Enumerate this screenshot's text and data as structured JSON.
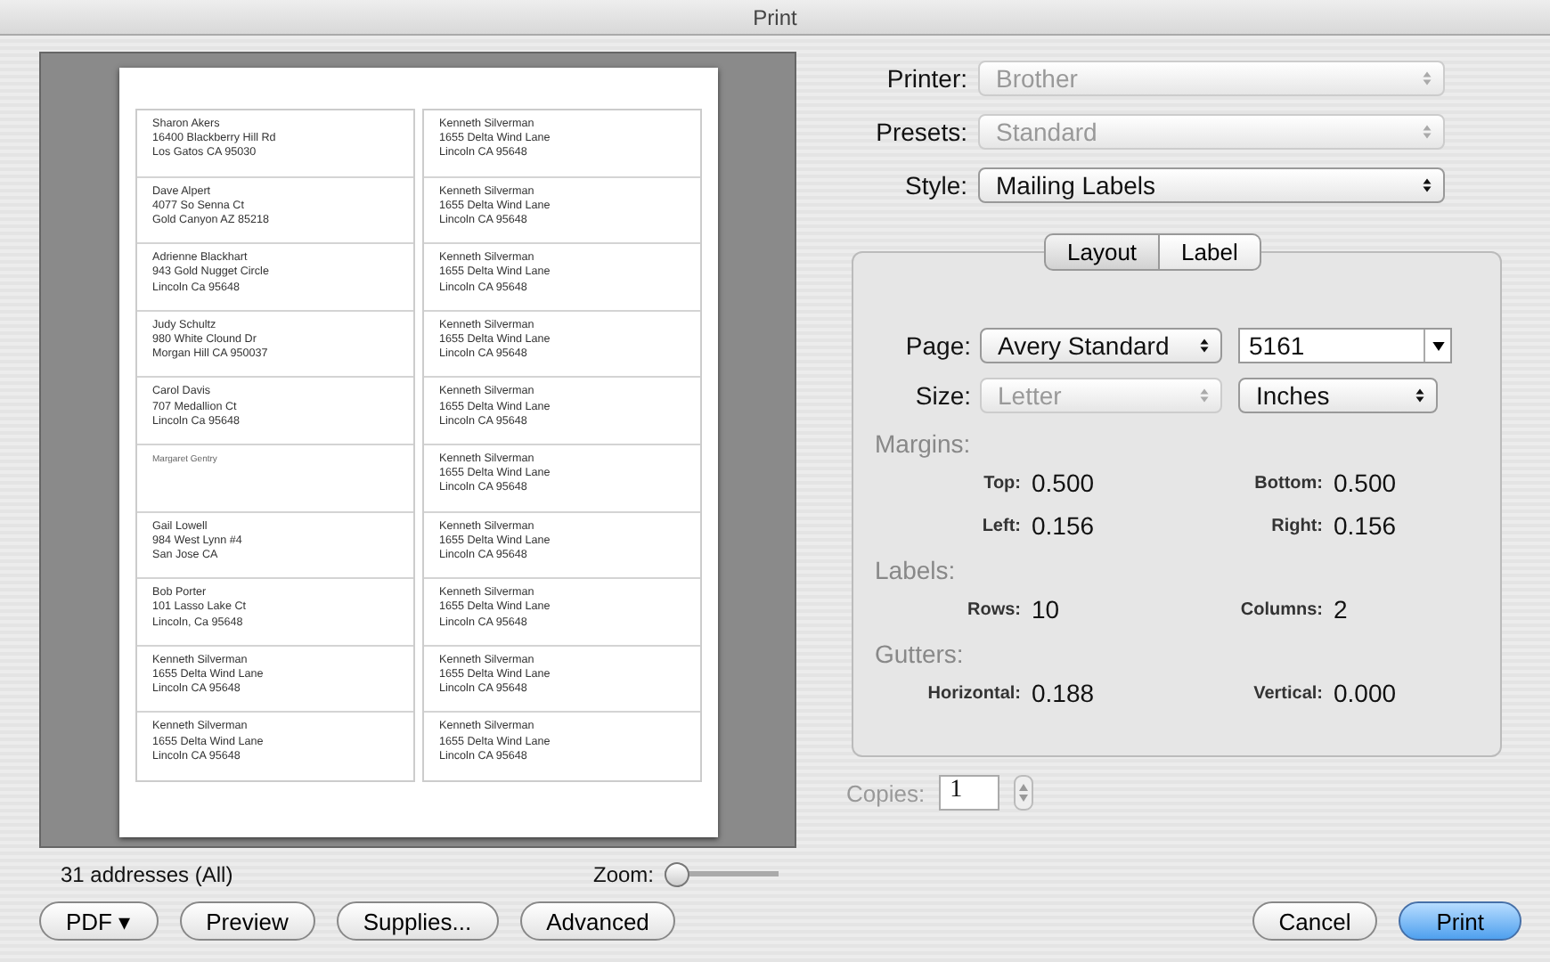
{
  "window": {
    "title": "Print"
  },
  "preview": {
    "labels_left": [
      {
        "lines": [
          "Sharon Akers",
          "16400 Blackberry Hill Rd",
          "Los Gatos CA 95030"
        ]
      },
      {
        "lines": [
          "Dave Alpert",
          "4077 So Senna Ct",
          "Gold Canyon AZ 85218"
        ]
      },
      {
        "lines": [
          "Adrienne Blackhart",
          "943 Gold Nugget Circle",
          "Lincoln Ca 95648"
        ]
      },
      {
        "lines": [
          "Judy Schultz",
          "980 White Clound Dr",
          "Morgan Hill CA 950037"
        ]
      },
      {
        "lines": [
          "Carol Davis",
          "707 Medallion Ct",
          "Lincoln Ca 95648"
        ]
      },
      {
        "lines": [
          "Margaret Gentry"
        ],
        "small": true
      },
      {
        "lines": [
          "Gail Lowell",
          "984 West Lynn #4",
          "San Jose CA"
        ]
      },
      {
        "lines": [
          "Bob Porter",
          "101 Lasso Lake Ct",
          "Lincoln, Ca 95648"
        ]
      },
      {
        "lines": [
          "Kenneth Silverman",
          "1655 Delta Wind Lane",
          "Lincoln CA 95648"
        ]
      },
      {
        "lines": [
          "Kenneth Silverman",
          "1655 Delta Wind Lane",
          "Lincoln CA 95648"
        ]
      }
    ],
    "labels_right": [
      {
        "lines": [
          "Kenneth Silverman",
          "1655 Delta Wind Lane",
          "Lincoln CA 95648"
        ]
      },
      {
        "lines": [
          "Kenneth Silverman",
          "1655 Delta Wind Lane",
          "Lincoln CA 95648"
        ]
      },
      {
        "lines": [
          "Kenneth Silverman",
          "1655 Delta Wind Lane",
          "Lincoln CA 95648"
        ]
      },
      {
        "lines": [
          "Kenneth Silverman",
          "1655 Delta Wind Lane",
          "Lincoln CA 95648"
        ]
      },
      {
        "lines": [
          "Kenneth Silverman",
          "1655 Delta Wind Lane",
          "Lincoln CA 95648"
        ]
      },
      {
        "lines": [
          "Kenneth Silverman",
          "1655 Delta Wind Lane",
          "Lincoln CA 95648"
        ]
      },
      {
        "lines": [
          "Kenneth Silverman",
          "1655 Delta Wind Lane",
          "Lincoln CA 95648"
        ]
      },
      {
        "lines": [
          "Kenneth Silverman",
          "1655 Delta Wind Lane",
          "Lincoln CA 95648"
        ]
      },
      {
        "lines": [
          "Kenneth Silverman",
          "1655 Delta Wind Lane",
          "Lincoln CA 95648"
        ]
      },
      {
        "lines": [
          "Kenneth Silverman",
          "1655 Delta Wind Lane",
          "Lincoln CA 95648"
        ]
      }
    ],
    "count": "31 addresses (All)",
    "zoom_label": "Zoom:",
    "zoom": {
      "level": 0
    }
  },
  "settings": [
    {
      "label": "Printer:",
      "value": "Brother",
      "disabled": true
    },
    {
      "label": "Presets:",
      "value": "Standard",
      "disabled": true
    },
    {
      "label": "Style:",
      "value": "Mailing Labels",
      "disabled": false
    }
  ],
  "tabs": [
    {
      "label": "Layout",
      "selected": true
    },
    {
      "label": "Label",
      "selected": false
    }
  ],
  "page": {
    "label": "Page:",
    "value": "Avery Standard",
    "disabled": false,
    "combo": "5161"
  },
  "size": {
    "label": "Size:",
    "value": "Letter",
    "disabled": true,
    "units": "Inches"
  },
  "groups": [
    {
      "title": "Margins:",
      "fields": [
        {
          "label": "Top:",
          "value": "0.500"
        },
        {
          "label": "Bottom:",
          "value": "0.500"
        },
        {
          "label": "Left:",
          "value": "0.156"
        },
        {
          "label": "Right:",
          "value": "0.156"
        }
      ]
    },
    {
      "title": "Labels:",
      "fields": [
        {
          "label": "Rows:",
          "value": "10"
        },
        {
          "label": "Columns:",
          "value": "2"
        }
      ]
    },
    {
      "title": "Gutters:",
      "fields": [
        {
          "label": "Horizontal:",
          "value": "0.188"
        },
        {
          "label": "Vertical:",
          "value": "0.000"
        }
      ]
    }
  ],
  "copies": {
    "label": "Copies:",
    "value": "1",
    "disabled": true
  },
  "buttons_left": [
    {
      "label": "PDF ▾",
      "default": false
    },
    {
      "label": "Preview",
      "default": false
    },
    {
      "label": "Supplies...",
      "default": false
    },
    {
      "label": "Advanced",
      "default": false
    }
  ],
  "buttons_right": [
    {
      "label": "Cancel",
      "default": false
    },
    {
      "label": "Print",
      "default": true
    }
  ]
}
